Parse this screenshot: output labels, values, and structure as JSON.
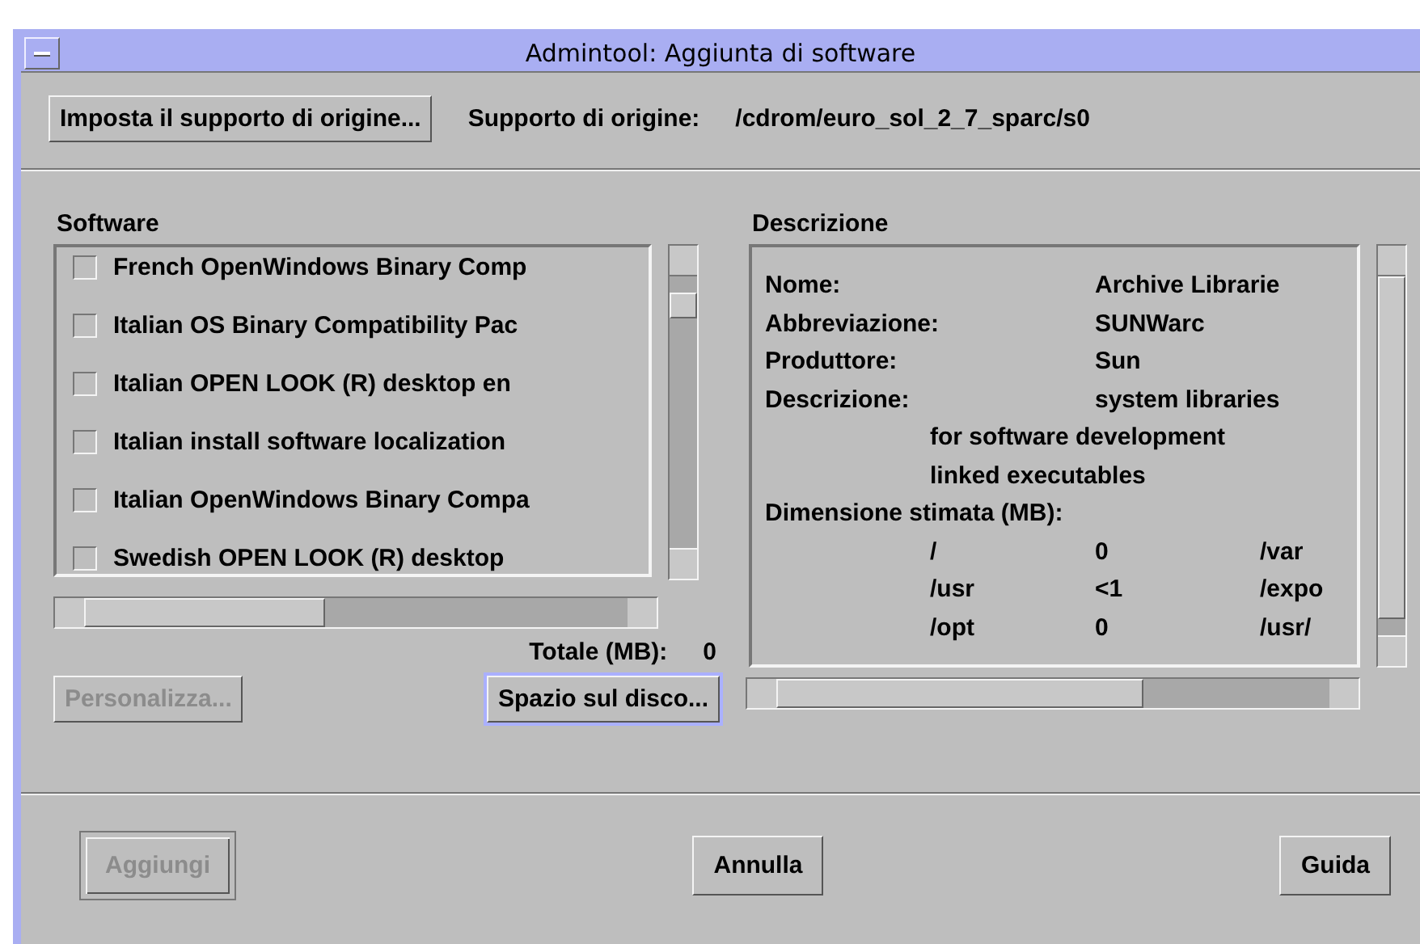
{
  "window": {
    "title": "Admintool: Aggiunta di software"
  },
  "source": {
    "button": "Imposta il supporto di origine...",
    "label": "Supporto di origine:",
    "path": "/cdrom/euro_sol_2_7_sparc/s0"
  },
  "software": {
    "heading": "Software",
    "items": [
      {
        "name": "French OpenWindows Binary Comp",
        "checked": false
      },
      {
        "name": "Italian OS Binary Compatibility Pac",
        "checked": false
      },
      {
        "name": "Italian OPEN LOOK (R) desktop en",
        "checked": false
      },
      {
        "name": "Italian install software localization",
        "checked": false
      },
      {
        "name": "Italian OpenWindows Binary Compa",
        "checked": false
      },
      {
        "name": "Swedish OPEN LOOK (R) desktop",
        "checked": false
      }
    ],
    "total_label": "Totale (MB):",
    "total_value": "0",
    "customize": {
      "label": "Personalizza...",
      "disabled": true
    },
    "disk_space": {
      "label": "Spazio sul disco...",
      "disabled": false,
      "focused": true
    }
  },
  "description": {
    "heading": "Descrizione",
    "fields": [
      {
        "label": "Nome:",
        "value": "Archive Librarie"
      },
      {
        "label": "Abbreviazione:",
        "value": "SUNWarc"
      },
      {
        "label": "Produttore:",
        "value": "Sun"
      },
      {
        "label": "Descrizione:",
        "value": "system libraries"
      }
    ],
    "continuation": [
      "for software development",
      "linked executables"
    ],
    "size_heading": "Dimensione stimata (MB):",
    "sizes": [
      {
        "fs": "/",
        "mb": "0",
        "fs_2": "/var"
      },
      {
        "fs": "/usr",
        "mb": "<1",
        "fs_2": "/expo"
      },
      {
        "fs": "/opt",
        "mb": "0",
        "fs_2": "/usr/"
      }
    ]
  },
  "actions": [
    {
      "label": "Aggiungi",
      "disabled": true,
      "default": true
    },
    {
      "label": "Annulla",
      "disabled": false,
      "default": false
    },
    {
      "label": "Guida",
      "disabled": false,
      "default": false
    }
  ]
}
